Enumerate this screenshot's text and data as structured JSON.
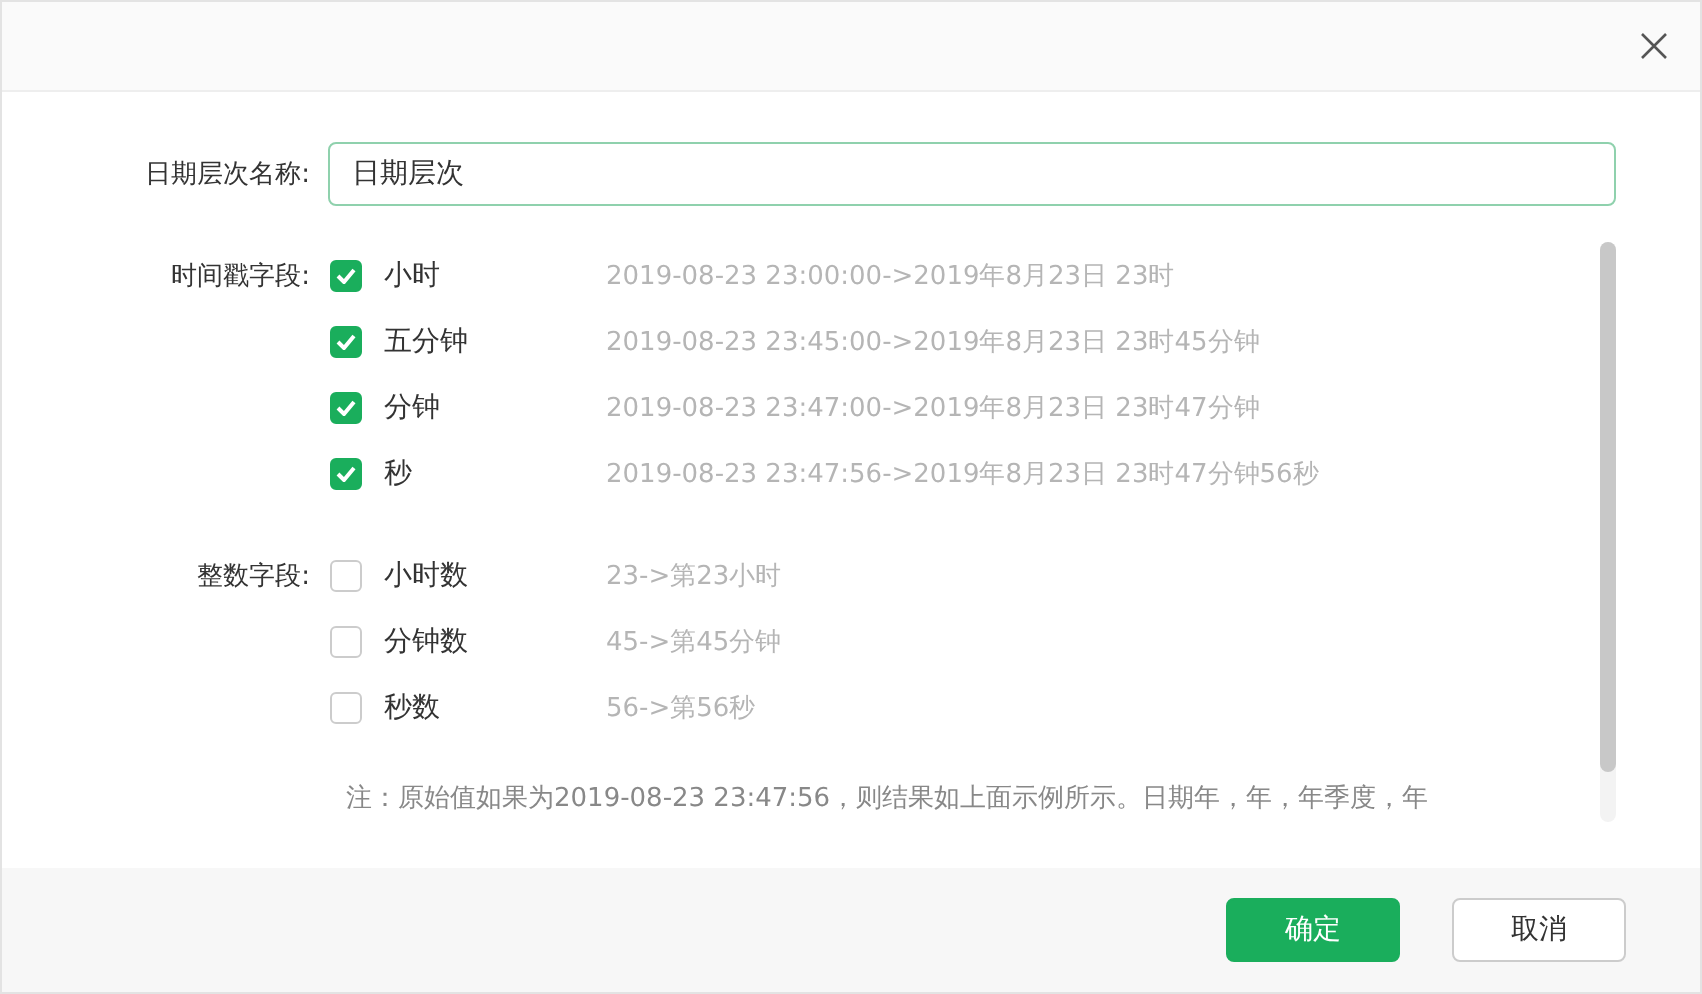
{
  "name_field": {
    "label": "日期层次名称:",
    "value": "日期层次"
  },
  "groups": [
    {
      "label": "时间戳字段:",
      "items": [
        {
          "label": "小时",
          "checked": true,
          "example": "2019-08-23 23:00:00->2019年8月23日 23时"
        },
        {
          "label": "五分钟",
          "checked": true,
          "example": "2019-08-23 23:45:00->2019年8月23日 23时45分钟"
        },
        {
          "label": "分钟",
          "checked": true,
          "example": "2019-08-23 23:47:00->2019年8月23日 23时47分钟"
        },
        {
          "label": "秒",
          "checked": true,
          "example": "2019-08-23 23:47:56->2019年8月23日 23时47分钟56秒"
        }
      ]
    },
    {
      "label": "整数字段:",
      "items": [
        {
          "label": "小时数",
          "checked": false,
          "example": "23->第23小时"
        },
        {
          "label": "分钟数",
          "checked": false,
          "example": "45->第45分钟"
        },
        {
          "label": "秒数",
          "checked": false,
          "example": "56->第56秒"
        }
      ]
    }
  ],
  "note": "注：原始值如果为2019-08-23 23:47:56，则结果如上面示例所示。日期年，年，年季度，年",
  "buttons": [
    {
      "label": "确定",
      "kind": "primary"
    },
    {
      "label": "取消",
      "kind": "secondary"
    }
  ]
}
